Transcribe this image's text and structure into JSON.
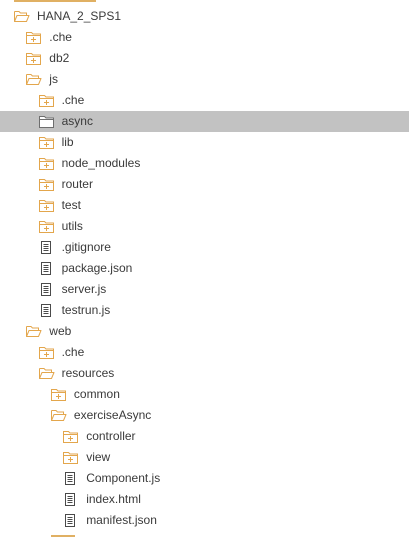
{
  "colors": {
    "folder_stroke": "#e3a64c",
    "file_stroke": "#4a4a4a",
    "selected_bg": "#c2c2c2",
    "text": "#3a3a3a"
  },
  "tree": {
    "rows": [
      {
        "label": "HANA_2_SPS1",
        "type": "folder-open",
        "depth": 0,
        "selected": false
      },
      {
        "label": ".che",
        "type": "folder-closed",
        "depth": 1,
        "selected": false
      },
      {
        "label": "db2",
        "type": "folder-closed",
        "depth": 1,
        "selected": false
      },
      {
        "label": "js",
        "type": "folder-open",
        "depth": 1,
        "selected": false
      },
      {
        "label": ".che",
        "type": "folder-closed",
        "depth": 2,
        "selected": false
      },
      {
        "label": "async",
        "type": "folder-empty",
        "depth": 2,
        "selected": true
      },
      {
        "label": "lib",
        "type": "folder-closed",
        "depth": 2,
        "selected": false
      },
      {
        "label": "node_modules",
        "type": "folder-closed",
        "depth": 2,
        "selected": false
      },
      {
        "label": "router",
        "type": "folder-closed",
        "depth": 2,
        "selected": false
      },
      {
        "label": "test",
        "type": "folder-closed",
        "depth": 2,
        "selected": false
      },
      {
        "label": "utils",
        "type": "folder-closed",
        "depth": 2,
        "selected": false
      },
      {
        "label": ".gitignore",
        "type": "file",
        "depth": 2,
        "selected": false
      },
      {
        "label": "package.json",
        "type": "file",
        "depth": 2,
        "selected": false
      },
      {
        "label": "server.js",
        "type": "file",
        "depth": 2,
        "selected": false
      },
      {
        "label": "testrun.js",
        "type": "file",
        "depth": 2,
        "selected": false
      },
      {
        "label": "web",
        "type": "folder-open",
        "depth": 1,
        "selected": false
      },
      {
        "label": ".che",
        "type": "folder-closed",
        "depth": 2,
        "selected": false
      },
      {
        "label": "resources",
        "type": "folder-open",
        "depth": 2,
        "selected": false
      },
      {
        "label": "common",
        "type": "folder-closed",
        "depth": 3,
        "selected": false
      },
      {
        "label": "exerciseAsync",
        "type": "folder-open",
        "depth": 3,
        "selected": false
      },
      {
        "label": "controller",
        "type": "folder-closed",
        "depth": 4,
        "selected": false
      },
      {
        "label": "view",
        "type": "folder-closed",
        "depth": 4,
        "selected": false
      },
      {
        "label": "Component.js",
        "type": "file",
        "depth": 4,
        "selected": false
      },
      {
        "label": "index.html",
        "type": "file",
        "depth": 4,
        "selected": false
      },
      {
        "label": "manifest.json",
        "type": "file",
        "depth": 4,
        "selected": false
      }
    ]
  }
}
